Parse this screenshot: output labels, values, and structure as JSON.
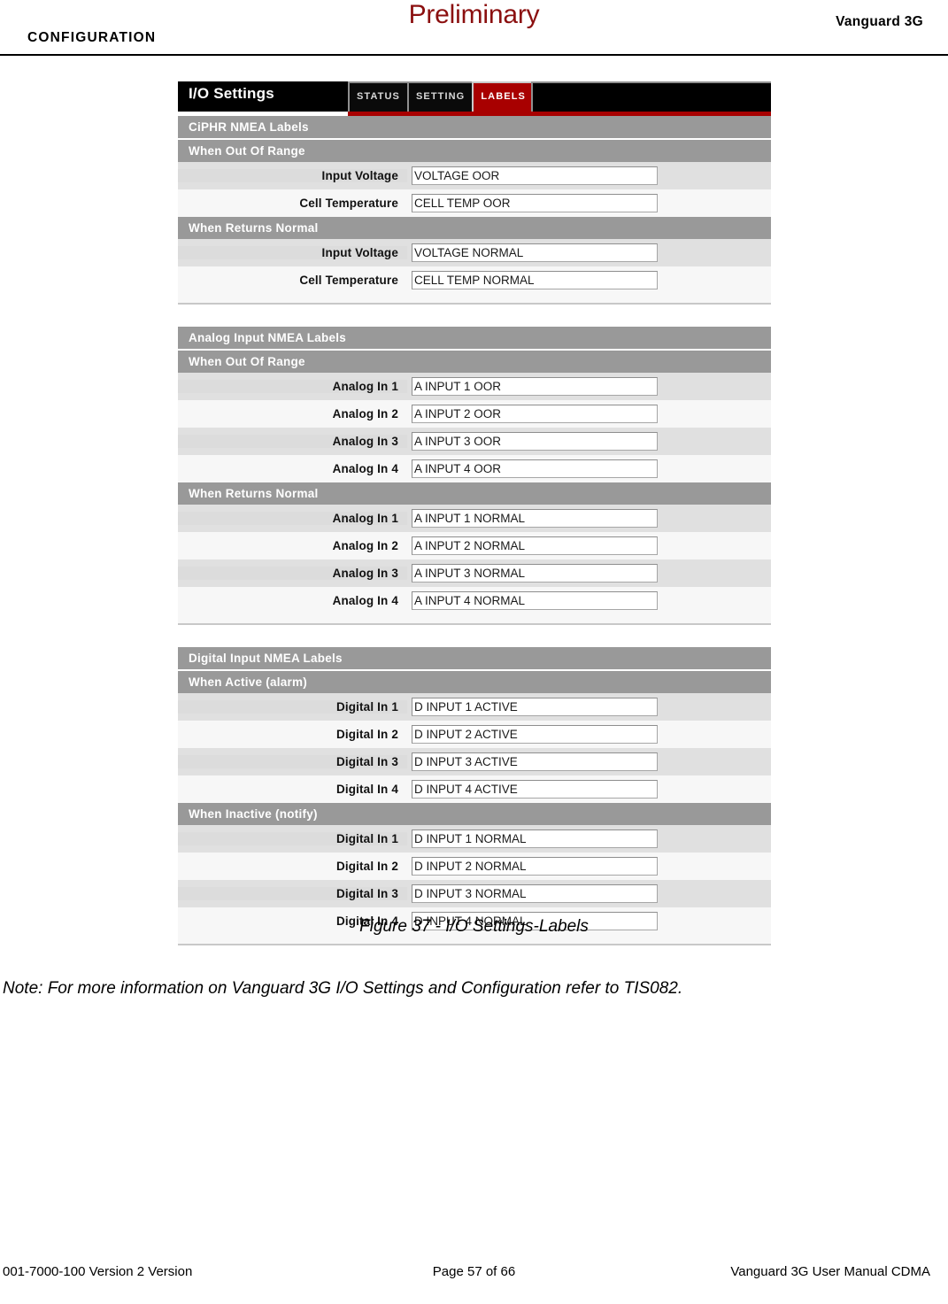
{
  "header": {
    "preliminary": "Preliminary",
    "product": "Vanguard 3G",
    "section": "CONFIGURATION"
  },
  "figure": {
    "caption": "Figure 37 - I/O Settings-Labels",
    "titlebar": {
      "title": "I/O Settings",
      "tabs": [
        {
          "label": "STATUS",
          "active": false
        },
        {
          "label": "SETTING",
          "active": false
        },
        {
          "label": "LABELS",
          "active": true
        }
      ]
    },
    "panels": [
      {
        "heading": "CiPHR NMEA Labels",
        "groups": [
          {
            "heading": "When Out Of Range",
            "rows": [
              {
                "label": "Input Voltage",
                "value": "VOLTAGE OOR"
              },
              {
                "label": "Cell Temperature",
                "value": "CELL TEMP OOR"
              }
            ]
          },
          {
            "heading": "When Returns Normal",
            "rows": [
              {
                "label": "Input Voltage",
                "value": "VOLTAGE NORMAL"
              },
              {
                "label": "Cell Temperature",
                "value": "CELL TEMP NORMAL"
              }
            ]
          }
        ]
      },
      {
        "heading": "Analog Input NMEA Labels",
        "groups": [
          {
            "heading": "When Out Of Range",
            "rows": [
              {
                "label": "Analog In 1",
                "value": "A INPUT 1 OOR"
              },
              {
                "label": "Analog In 2",
                "value": "A INPUT 2 OOR"
              },
              {
                "label": "Analog In 3",
                "value": "A INPUT 3 OOR"
              },
              {
                "label": "Analog In 4",
                "value": "A INPUT 4 OOR"
              }
            ]
          },
          {
            "heading": "When Returns Normal",
            "rows": [
              {
                "label": "Analog In 1",
                "value": "A INPUT 1 NORMAL"
              },
              {
                "label": "Analog In 2",
                "value": "A INPUT 2 NORMAL"
              },
              {
                "label": "Analog In 3",
                "value": "A INPUT 3 NORMAL"
              },
              {
                "label": "Analog In 4",
                "value": "A INPUT 4 NORMAL"
              }
            ]
          }
        ]
      },
      {
        "heading": "Digital Input NMEA Labels",
        "groups": [
          {
            "heading": "When Active (alarm)",
            "rows": [
              {
                "label": "Digital In 1",
                "value": "D INPUT 1 ACTIVE"
              },
              {
                "label": "Digital In 2",
                "value": "D INPUT 2 ACTIVE"
              },
              {
                "label": "Digital In 3",
                "value": "D INPUT 3 ACTIVE"
              },
              {
                "label": "Digital In 4",
                "value": "D INPUT 4 ACTIVE"
              }
            ]
          },
          {
            "heading": "When Inactive (notify)",
            "rows": [
              {
                "label": "Digital In 1",
                "value": "D INPUT 1 NORMAL"
              },
              {
                "label": "Digital In 2",
                "value": "D INPUT 2 NORMAL"
              },
              {
                "label": "Digital In 3",
                "value": "D INPUT 3 NORMAL"
              },
              {
                "label": "Digital In 4",
                "value": "D INPUT 4 NORMAL"
              }
            ]
          }
        ]
      }
    ]
  },
  "note": "Note: For more information on Vanguard 3G  I/O Settings and Configuration refer to TIS082.",
  "footer": {
    "left": "001-7000-100 Version 2 Version",
    "center": "Page 57 of 66",
    "right": "Vanguard 3G  User Manual CDMA"
  },
  "colors": {
    "accent_red": "#a80000",
    "preliminary_red": "#8b0f0f",
    "section_gray": "#999999",
    "row_alt": "#e0e0e0",
    "row_base": "#f7f7f7"
  }
}
